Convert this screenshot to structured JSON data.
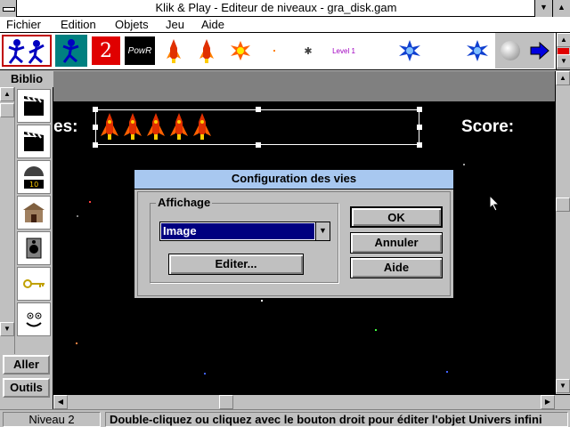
{
  "window": {
    "title": "Klik & Play - Editeur de niveaux - gra_disk.gam"
  },
  "menu": [
    {
      "label": "Fichier"
    },
    {
      "label": "Edition"
    },
    {
      "label": "Objets"
    },
    {
      "label": "Jeu"
    },
    {
      "label": "Aide"
    }
  ],
  "toolbar": {
    "level_text": "Level 1",
    "objects": [
      "runner",
      "number-2",
      "powr-text",
      "rocket-red",
      "rocket-red-2",
      "explosion",
      "dot",
      "spark",
      "level-text",
      "blue-spinner",
      "blue-spinner-2",
      "gray-ball",
      "blue-arrow"
    ]
  },
  "left_panel": {
    "title": "Biblio",
    "items": [
      "clapper",
      "clapper-2",
      "counter-10",
      "building",
      "speaker",
      "key",
      "smiley"
    ],
    "aller_label": "Aller",
    "outils_label": "Outils"
  },
  "play_area": {
    "lives_label": "es:",
    "score_label": "Score:",
    "lives_count": 5
  },
  "dialog": {
    "title": "Configuration des vies",
    "group_label": "Affichage",
    "select_value": "Image",
    "edit_label": "Editer...",
    "ok_label": "OK",
    "cancel_label": "Annuler",
    "help_label": "Aide"
  },
  "status": {
    "level": "Niveau 2",
    "message": "Double-cliquez ou cliquez avec le bouton droit pour éditer l'objet Univers infini"
  },
  "colors": {
    "dialog_title_bg": "#a8c8f0",
    "selection": "#000080",
    "play_bg": "#000000"
  }
}
